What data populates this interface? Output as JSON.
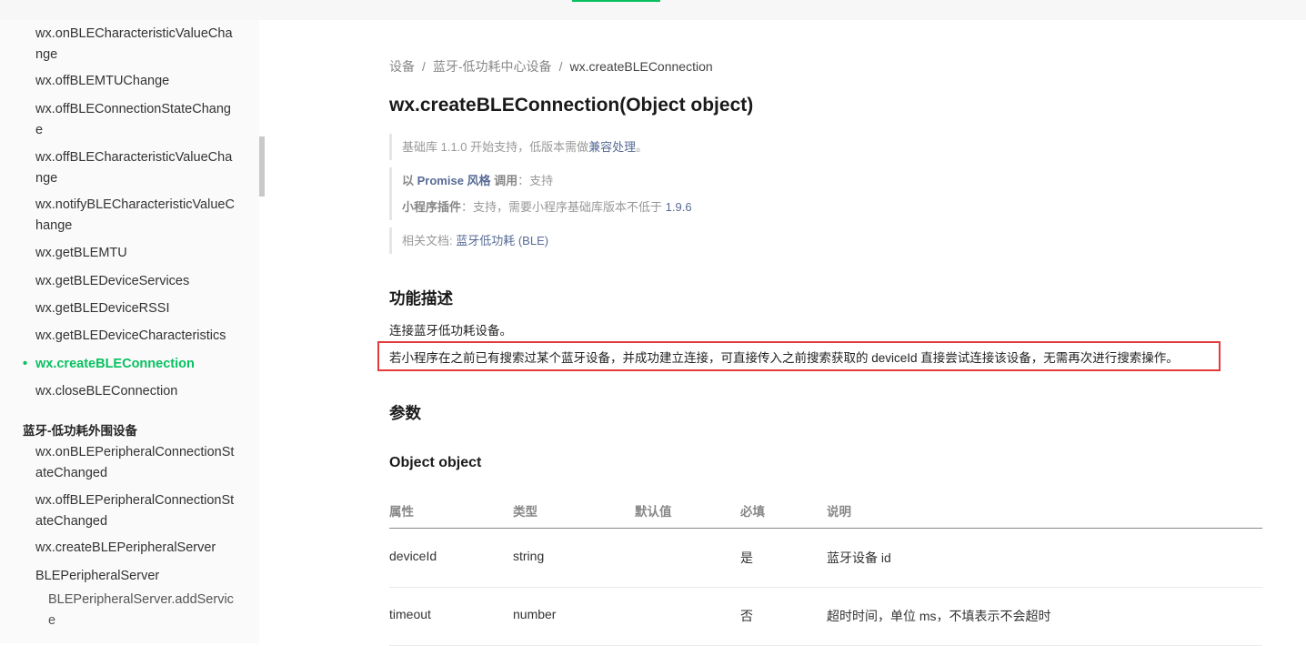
{
  "sidebar": {
    "items": [
      {
        "label": "wx.onBLECharacteristicValueChange"
      },
      {
        "label": "wx.offBLEMTUChange"
      },
      {
        "label": "wx.offBLEConnectionStateChange"
      },
      {
        "label": "wx.offBLECharacteristicValueChange"
      },
      {
        "label": "wx.notifyBLECharacteristicValueChange"
      },
      {
        "label": "wx.getBLEMTU"
      },
      {
        "label": "wx.getBLEDeviceServices"
      },
      {
        "label": "wx.getBLEDeviceRSSI"
      },
      {
        "label": "wx.getBLEDeviceCharacteristics"
      },
      {
        "label": "wx.createBLEConnection"
      },
      {
        "label": "wx.closeBLEConnection"
      }
    ],
    "group_title": "蓝牙-低功耗外围设备",
    "group_items": [
      {
        "label": "wx.onBLEPeripheralConnectionStateChanged"
      },
      {
        "label": "wx.offBLEPeripheralConnectionStateChanged"
      },
      {
        "label": "wx.createBLEPeripheralServer"
      },
      {
        "label": "BLEPeripheralServer"
      },
      {
        "label": "BLEPeripheralServer.addService"
      }
    ],
    "active_dot": "•"
  },
  "breadcrumb": {
    "items": [
      "设备",
      "蓝牙-低功耗中心设备"
    ],
    "current": "wx.createBLEConnection",
    "separator": "/"
  },
  "title": "wx.createBLEConnection(Object object)",
  "notes": {
    "support_prefix": "基础库 1.1.0 开始支持，低版本需做",
    "support_link": "兼容处理",
    "support_suffix": "。",
    "promise_prefix": "以 ",
    "promise_link": "Promise 风格",
    "promise_call": " 调用",
    "promise_value": "：支持",
    "plugin_label": "小程序插件",
    "plugin_value": "：支持，需要小程序基础库版本不低于 ",
    "plugin_version": "1.9.6",
    "doc_label": "相关文档: ",
    "doc_link": "蓝牙低功耗 (BLE)"
  },
  "description": {
    "heading": "功能描述",
    "line1": "连接蓝牙低功耗设备。",
    "line2": "若小程序在之前已有搜索过某个蓝牙设备，并成功建立连接，可直接传入之前搜索获取的 deviceId 直接尝试连接该设备，无需再次进行搜索操作。"
  },
  "params": {
    "heading": "参数",
    "object_title": "Object object",
    "columns": [
      "属性",
      "类型",
      "默认值",
      "必填",
      "说明"
    ],
    "rows": [
      [
        "deviceId",
        "string",
        "",
        "是",
        "蓝牙设备 id"
      ],
      [
        "timeout",
        "number",
        "",
        "否",
        "超时时间，单位 ms，不填表示不会超时"
      ]
    ]
  },
  "colors": {
    "accent": "#07c160",
    "link": "#576b95",
    "highlight_border": "#e33b3b"
  }
}
